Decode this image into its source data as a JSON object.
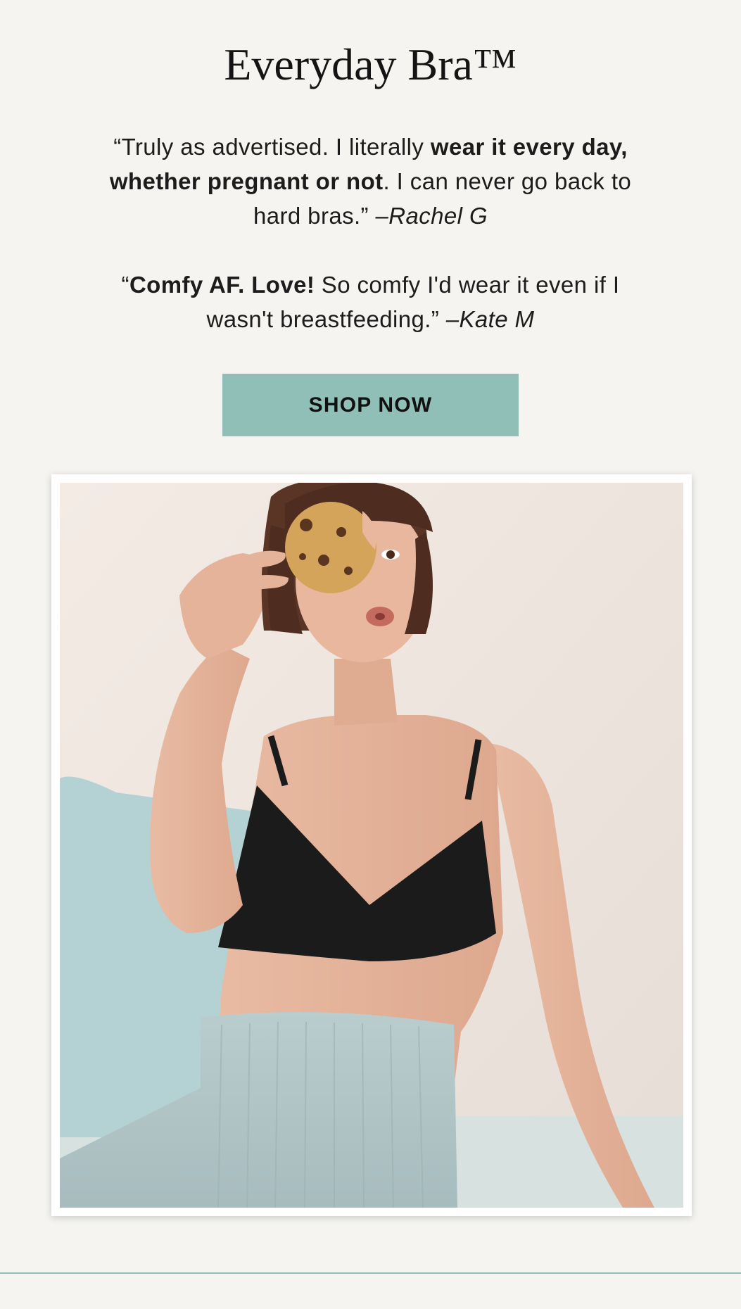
{
  "title": "Everyday Bra™",
  "quotes": [
    {
      "open": "“Truly as advertised. I literally ",
      "bold": "wear it every day, whether pregnant or not",
      "rest": ". I can never go back to hard bras.” ",
      "author": "–Rachel G"
    },
    {
      "open": "“",
      "bold": "Comfy AF. Love!",
      "rest": " So comfy I'd wear it even if I wasn't breastfeeding.” ",
      "author": "–Kate M"
    }
  ],
  "cta": {
    "label": "SHOP NOW"
  },
  "colors": {
    "background": "#f5f4f0",
    "accent": "#8fbfb6",
    "text": "#1a1a1a"
  }
}
